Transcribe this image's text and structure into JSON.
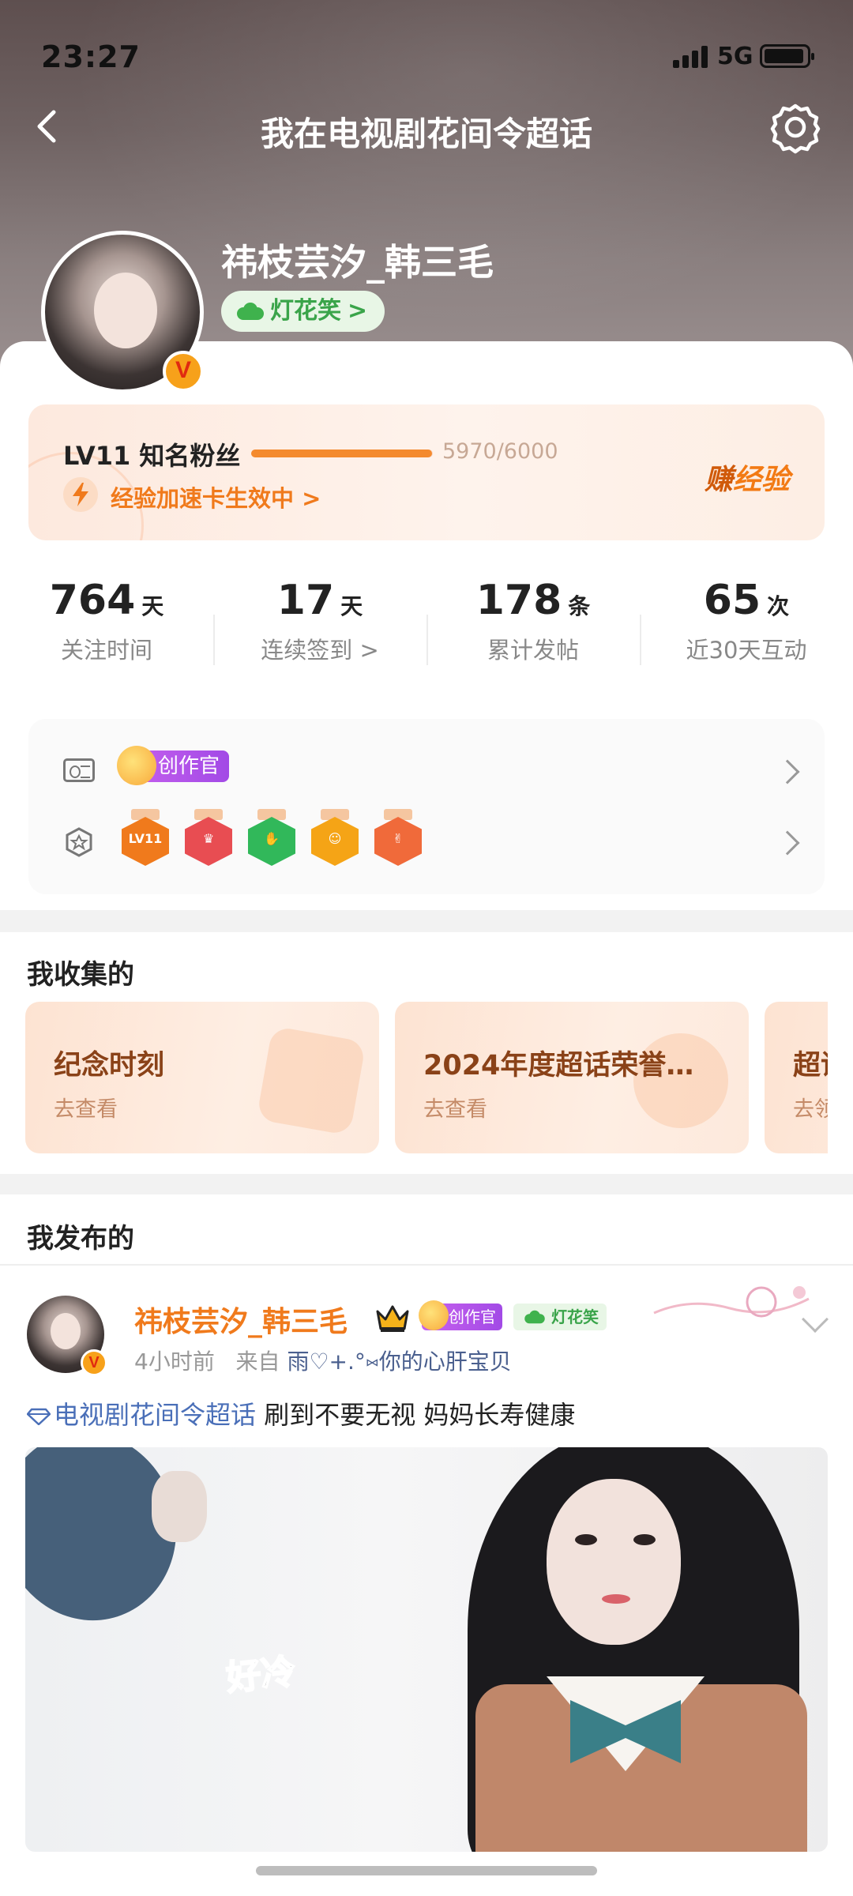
{
  "status_bar": {
    "time": "23:27",
    "network": "5G"
  },
  "nav": {
    "title": "我在电视剧花间令超话"
  },
  "profile": {
    "name": "祎枝芸汐_韩三毛",
    "fan_tag": "灯花笑",
    "fan_tag_arrow": ">",
    "verified_badge": "V"
  },
  "level": {
    "title": "LV11 知名粉丝",
    "progress_text": "5970/6000",
    "progress_fraction": 0.995,
    "boost_text": "经验加速卡生效中 >",
    "earn_label_a": "赚",
    "earn_label_b": "经验"
  },
  "stats": [
    {
      "value": "764",
      "unit": "天",
      "label": "关注时间"
    },
    {
      "value": "17",
      "unit": "天",
      "label": "连续签到 >"
    },
    {
      "value": "178",
      "unit": "条",
      "label": "累计发帖"
    },
    {
      "value": "65",
      "unit": "次",
      "label": "近30天互动"
    }
  ],
  "badges": {
    "creator_tag": "创作官",
    "medals": [
      {
        "icon": "lv11-medal-icon",
        "glyph": "LV11",
        "color": "#f07a1c"
      },
      {
        "icon": "trophy-medal-icon",
        "glyph": "♛",
        "color": "#e84d52"
      },
      {
        "icon": "hand-medal-icon",
        "glyph": "✋",
        "color": "#31b85a"
      },
      {
        "icon": "emoji-medal-icon",
        "glyph": "☺",
        "color": "#f5a416"
      },
      {
        "icon": "rock-medal-icon",
        "glyph": "✌",
        "color": "#f06a3a"
      }
    ]
  },
  "collections": {
    "title": "我收集的",
    "items": [
      {
        "title": "纪念时刻",
        "subtitle": "去查看"
      },
      {
        "title": "2024年度超话荣誉…",
        "subtitle": "去查看"
      },
      {
        "title": "超话",
        "subtitle": "去领"
      }
    ]
  },
  "posts": {
    "title": "我发布的",
    "author": "祎枝芸汐_韩三毛",
    "creator_tag": "创作官",
    "fan_tag": "灯花笑",
    "time": "4小时前",
    "source_prefix": "来自",
    "source": "雨♡+.°⑅你的心肝宝贝",
    "topic": "电视剧花间令超话",
    "text": "刷到不要无视 妈妈长寿健康",
    "image_caption": "好冷"
  },
  "colors": {
    "accent_orange": "#f07a1c",
    "topic_blue": "#4a6fb8",
    "fan_green": "#3aa44a",
    "creator_purple": "#b556ea"
  }
}
